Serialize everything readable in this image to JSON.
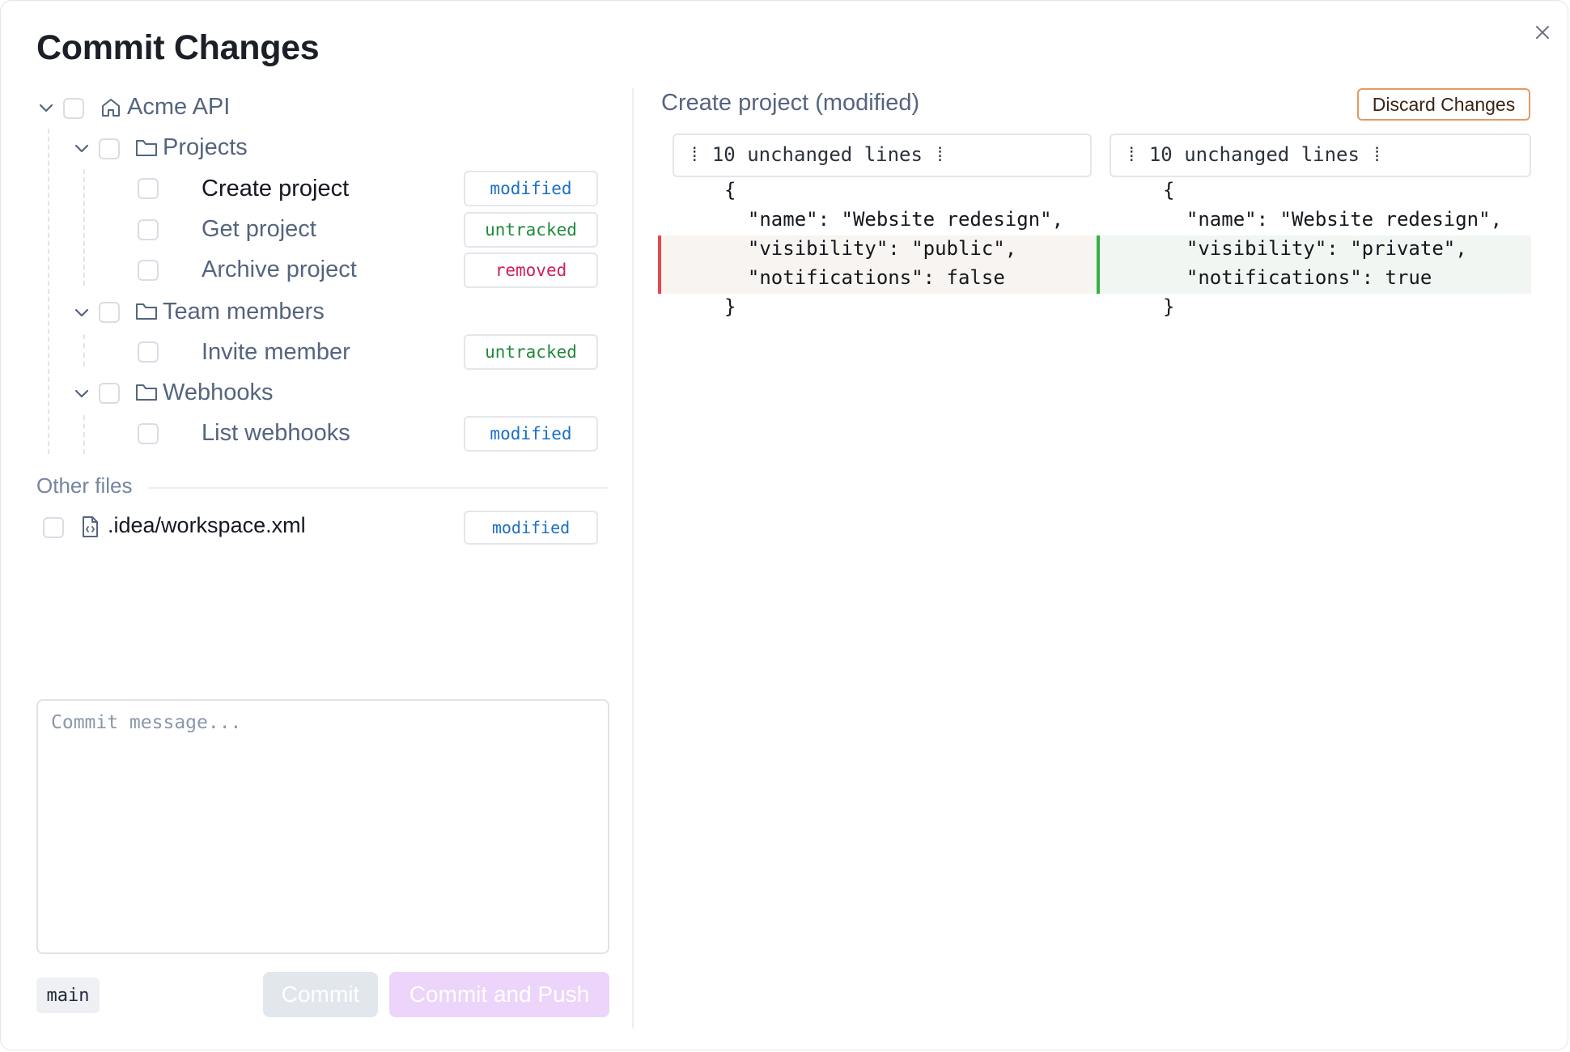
{
  "dialog": {
    "title": "Commit Changes"
  },
  "tree": {
    "root": {
      "label": "Acme API"
    },
    "folders": [
      {
        "label": "Projects"
      },
      {
        "label": "Team members"
      },
      {
        "label": "Webhooks"
      }
    ],
    "items": [
      {
        "label": "Create project",
        "status": "modified"
      },
      {
        "label": "Get project",
        "status": "untracked"
      },
      {
        "label": "Archive project",
        "status": "removed"
      },
      {
        "label": "Invite member",
        "status": "untracked"
      },
      {
        "label": "List webhooks",
        "status": "modified"
      }
    ]
  },
  "other_files": {
    "heading": "Other files",
    "items": [
      {
        "label": ".idea/workspace.xml",
        "status": "modified"
      }
    ]
  },
  "commit": {
    "placeholder": "Commit message...",
    "branch": "main",
    "commit_label": "Commit",
    "push_label": "Commit and Push"
  },
  "diff": {
    "title": "Create project (modified)",
    "discard_label": "Discard Changes",
    "left": {
      "collapsed": "⁞ 10 unchanged lines ⁞",
      "lines": [
        "{",
        "  \"name\": \"Website redesign\",",
        "  \"visibility\": \"public\",",
        "  \"notifications\": false",
        "}"
      ]
    },
    "right": {
      "collapsed": "⁞ 10 unchanged lines ⁞",
      "lines": [
        "{",
        "  \"name\": \"Website redesign\",",
        "  \"visibility\": \"private\",",
        "  \"notifications\": true",
        "}"
      ]
    }
  },
  "colors": {
    "modified": "#1a6fc4",
    "untracked": "#208a3c",
    "removed": "#d0205c",
    "deletion_bar": "#e5484d",
    "addition_bar": "#2fb344",
    "push_button": "#ecd4fb"
  },
  "icons": [
    "close-icon",
    "chevron-down-icon",
    "home-icon",
    "folder-icon",
    "xml-file-icon"
  ]
}
